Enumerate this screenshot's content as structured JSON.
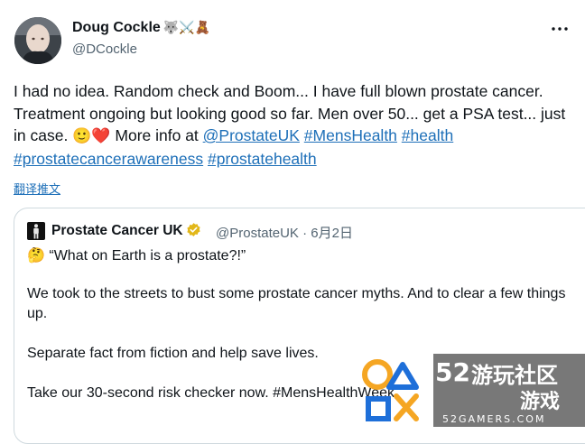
{
  "author": {
    "name": "Doug Cockle",
    "name_emojis": "🐺⚔️🧸",
    "handle": "@DCockle"
  },
  "menu_icon": "more-dots-icon",
  "tweet": {
    "segments": [
      {
        "text": "I had no idea. Random check and Boom... I have full blown prostate cancer. Treatment ongoing but looking good so far. Men over 50... get a PSA test... just in case. ",
        "link": false
      },
      {
        "text": "🙂❤️",
        "link": false
      },
      {
        "text": " More info at ",
        "link": false
      },
      {
        "text": "@ProstateUK",
        "link": true
      },
      {
        "text": " ",
        "link": false
      },
      {
        "text": "#MensHealth",
        "link": true
      },
      {
        "text": " ",
        "link": false
      },
      {
        "text": "#health",
        "link": true
      },
      {
        "text": " ",
        "link": false
      },
      {
        "text": "#prostatecancerawareness",
        "link": true
      },
      {
        "text": " ",
        "link": false
      },
      {
        "text": "#prostatehealth",
        "link": true
      }
    ],
    "translate_label": "翻译推文"
  },
  "quoted": {
    "name": "Prostate Cancer UK",
    "handle_date": "@ProstateUK · 6月2日",
    "line1_emoji": "🤔",
    "line1_text": "“What on Earth is a prostate?!”",
    "paragraphs": [
      "We took to the streets to bust some prostate cancer myths. And to clear a few things up.",
      "Separate fact from fiction and help save lives.",
      "Take our 30-second risk checker now. #MensHealthWeek"
    ]
  },
  "watermark": {
    "number": "52",
    "title": "游玩社区",
    "subtitle": "游戏",
    "domain": "52GAMERS.COM"
  },
  "colors": {
    "link": "#1d6fb8",
    "secondary_text": "#536471",
    "border": "#cfd9de",
    "verified_gold": "#e2b719"
  }
}
